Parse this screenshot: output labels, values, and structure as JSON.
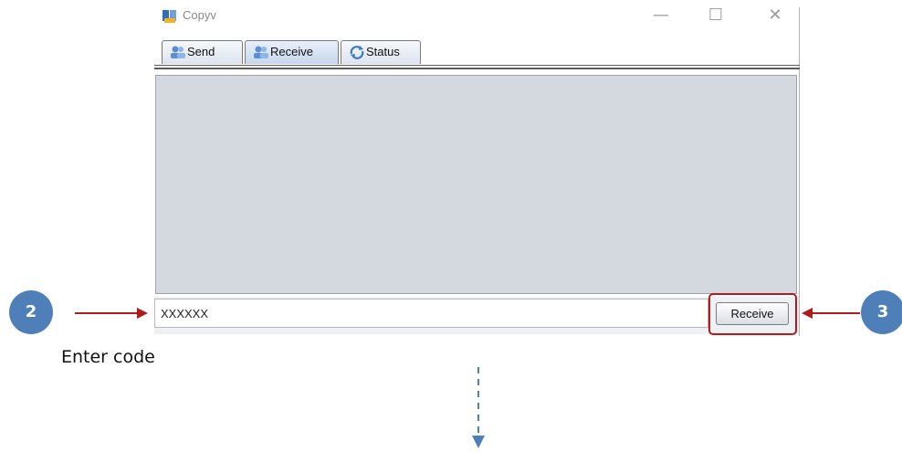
{
  "window": {
    "title": "Copyv",
    "controls": {
      "minimize": "—",
      "maximize": "☐",
      "close": "✕"
    }
  },
  "tabs": [
    {
      "label": "Send",
      "icon": "users-icon",
      "active": false
    },
    {
      "label": "Receive",
      "icon": "users-icon",
      "active": true
    },
    {
      "label": "Status",
      "icon": "refresh-status-icon",
      "active": false
    }
  ],
  "receive_panel": {
    "code_value": "XXXXXX",
    "button_label": "Receive"
  },
  "annotations": {
    "step2": "2",
    "step3": "3",
    "caption": "Enter code",
    "arrow_color": "#b01b1b",
    "badge_color": "#4f7fb9",
    "flow_arrow_color": "#4f7fb9"
  }
}
